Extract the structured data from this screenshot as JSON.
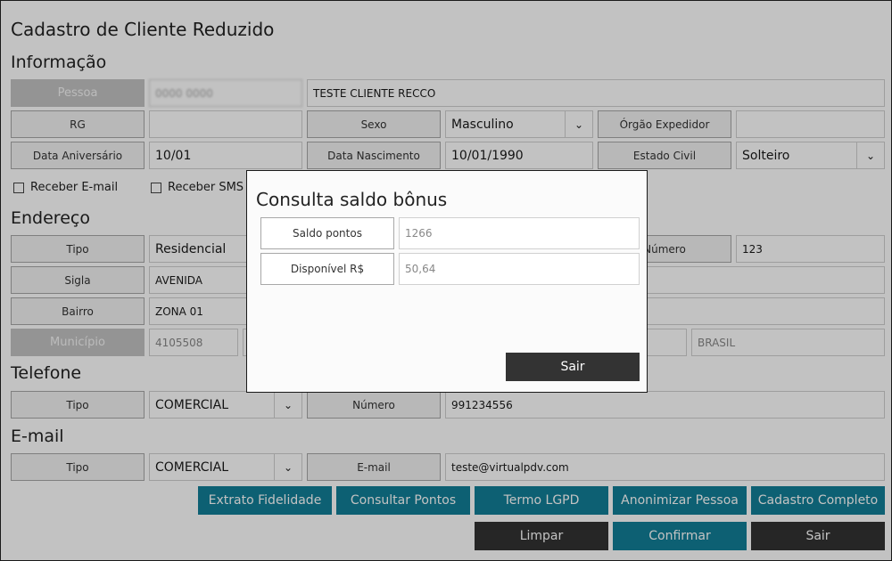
{
  "form_title": "Cadastro de Cliente Reduzido",
  "info": {
    "section": "Informação",
    "pessoa_label": "Pessoa",
    "pessoa_code": "0000 0000",
    "pessoa_name": "TESTE CLIENTE RECCO",
    "rg_label": "RG",
    "rg_value": "",
    "sexo_label": "Sexo",
    "sexo_value": "Masculino",
    "orgao_label": "Órgão Expedidor",
    "orgao_value": "",
    "aniversario_label": "Data Aniversário",
    "aniversario_value": "10/01",
    "nascimento_label": "Data Nascimento",
    "nascimento_value": "10/01/1990",
    "estado_civil_label": "Estado Civil",
    "estado_civil_value": "Solteiro",
    "receber_email": "Receber E-mail",
    "receber_sms": "Receber SMS"
  },
  "endereco": {
    "section": "Endereço",
    "tipo_label": "Tipo",
    "tipo_value": "Residencial",
    "numero_label": "Número",
    "numero_value": "123",
    "sigla_label": "Sigla",
    "sigla_value": "AVENIDA",
    "bairro_label": "Bairro",
    "bairro_value": "ZONA 01",
    "municipio_label": "Município",
    "municipio_code": "4105508",
    "pais_value": "BRASIL"
  },
  "telefone": {
    "section": "Telefone",
    "tipo_label": "Tipo",
    "tipo_value": "COMERCIAL",
    "numero_label": "Número",
    "numero_value": "991234556"
  },
  "email": {
    "section": "E-mail",
    "tipo_label": "Tipo",
    "tipo_value": "COMERCIAL",
    "email_label": "E-mail",
    "email_value": "teste@virtualpdv.com"
  },
  "buttons": {
    "extrato": "Extrato Fidelidade",
    "consultar": "Consultar Pontos",
    "termo": "Termo LGPD",
    "anonimizar": "Anonimizar Pessoa",
    "cadastro": "Cadastro Completo",
    "limpar": "Limpar",
    "confirmar": "Confirmar",
    "sair": "Sair"
  },
  "modal": {
    "title": "Consulta saldo bônus",
    "saldo_label": "Saldo pontos",
    "saldo_value": "1266",
    "disponivel_label": "Disponível R$",
    "disponivel_value": "50,64",
    "sair": "Sair"
  },
  "colors": {
    "accent": "#127f97",
    "dark": "#333333",
    "disabled": "#c3c3c3"
  },
  "icons": {
    "dropdown": "chevron-down-icon",
    "checkbox": "checkbox-icon"
  }
}
